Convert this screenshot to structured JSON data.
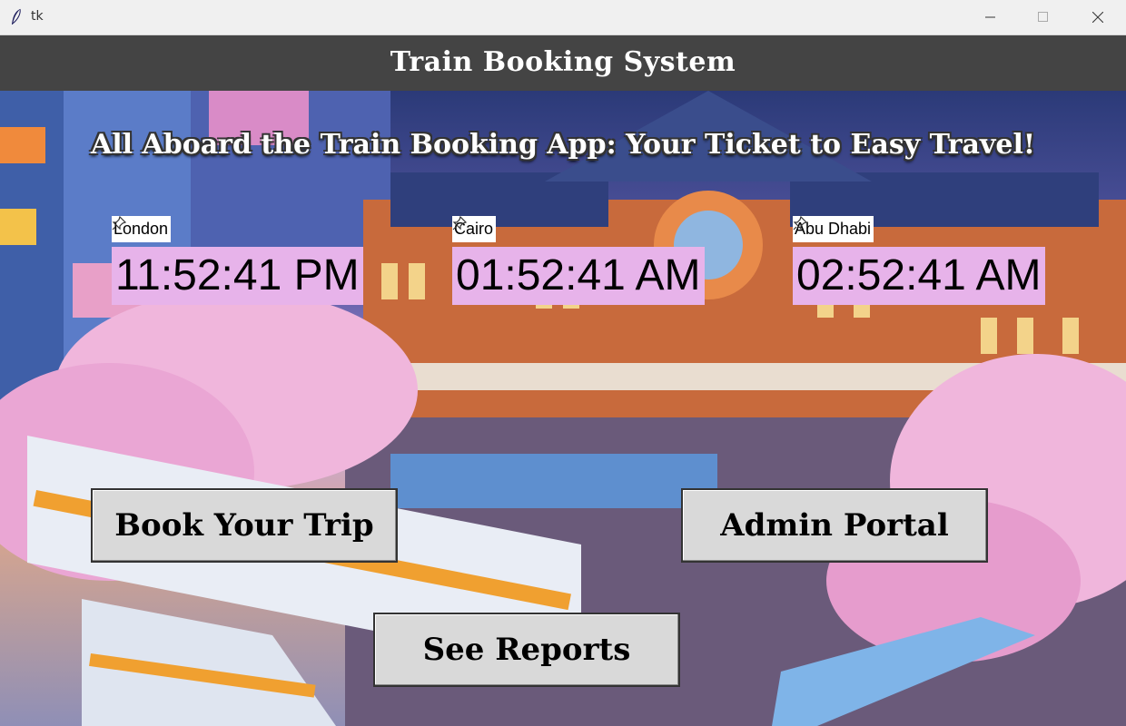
{
  "window": {
    "title": "tk"
  },
  "header": {
    "title": "Train Booking System"
  },
  "tagline": "All Aboard the Train Booking App: Your Ticket to Easy Travel!",
  "clocks": [
    {
      "city": "London",
      "time": "11:52:41 PM"
    },
    {
      "city": "Cairo",
      "time": "01:52:41 AM"
    },
    {
      "city": "Abu Dhabi",
      "time": "02:52:41 AM"
    }
  ],
  "buttons": {
    "book": "Book Your Trip",
    "admin": "Admin Portal",
    "reports": "See Reports"
  },
  "colors": {
    "header_bg": "#444444",
    "clock_bg": "#e7b3ea",
    "button_bg": "#d9d9d9"
  },
  "icons": {
    "window": "feather-icon",
    "city": "pin-icon"
  }
}
